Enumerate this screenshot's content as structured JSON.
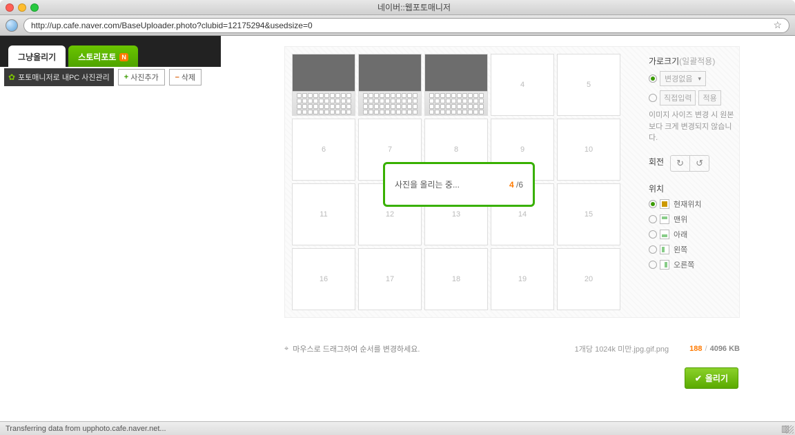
{
  "window": {
    "title": "네이버::웹포토매니저"
  },
  "url": "http://up.cafe.naver.com/BaseUploader.photo?clubid=12175294&usedsize=0",
  "tabs": {
    "upload": "그냥올리기",
    "story": "스토리포토",
    "badge": "N"
  },
  "toolbar": {
    "manager": "포토매니저로 내PC 사진관리",
    "add": "사진추가",
    "delete": "삭제"
  },
  "slots": [
    "",
    "",
    "",
    "4",
    "5",
    "6",
    "7",
    "8",
    "9",
    "10",
    "11",
    "12",
    "13",
    "14",
    "15",
    "16",
    "17",
    "18",
    "19",
    "20"
  ],
  "popup": {
    "text": "사진을 올리는 중...",
    "current": "4",
    "total": "/6"
  },
  "side": {
    "width_hdr": "가로크기",
    "width_sub": "(일괄적용)",
    "nochange": "변경없음",
    "direct": "직접입력",
    "apply": "적용",
    "note": "이미지 사이즈 변경 시 원본보다 크게 변경되지 않습니다.",
    "rotate": "회전",
    "pos_hdr": "위치",
    "pos": {
      "cur": "현재위치",
      "top": "맨위",
      "bot": "아래",
      "left": "왼쪽",
      "right": "오른쪽"
    }
  },
  "footer": {
    "drag": "마우스로 드래그하여 순서를 변경하세요.",
    "hint": "1개당 1024k 미만.jpg.gif.png",
    "used": "188",
    "sep": "/",
    "max": "4096 KB"
  },
  "upload_btn": "올리기",
  "status": "Transferring data from upphoto.cafe.naver.net..."
}
